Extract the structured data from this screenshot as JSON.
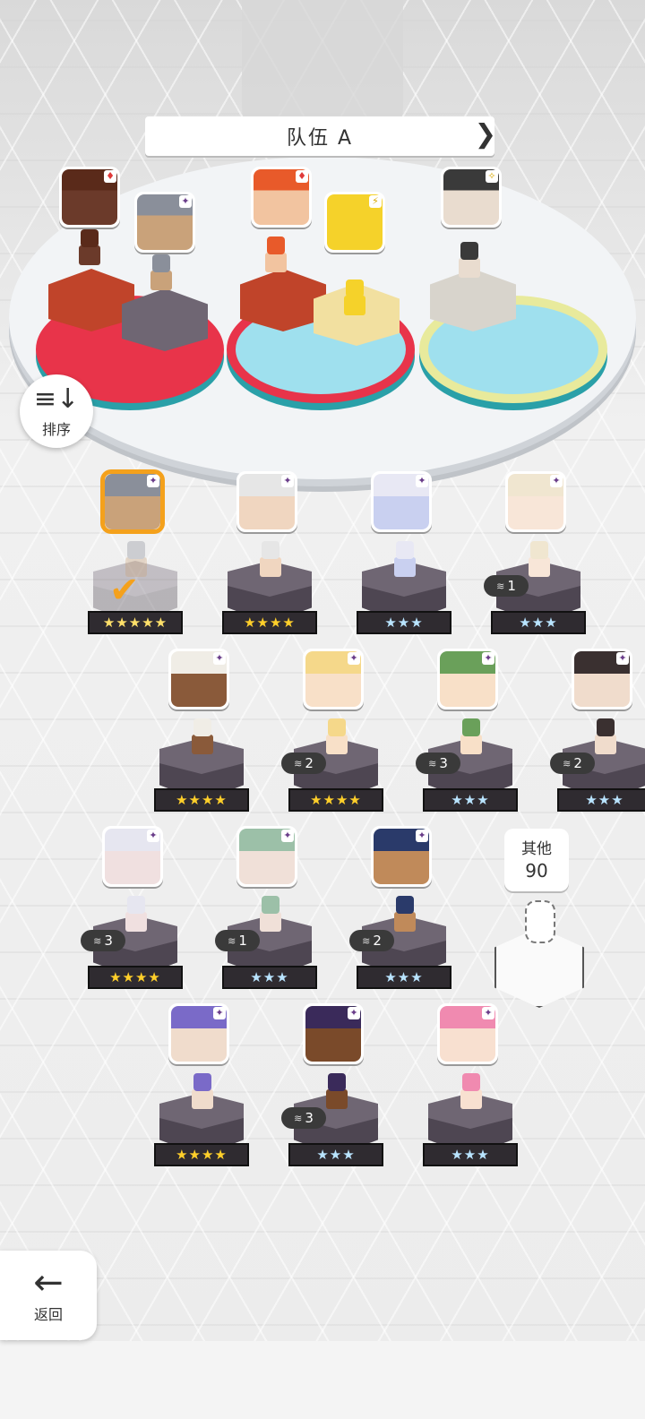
{
  "team": {
    "name": "队伍 A",
    "prev_arrow": "❮",
    "next_arrow": "❯",
    "slots": [
      {
        "ring_color": "#e8344a",
        "inner_color": "#e8344a"
      },
      {
        "ring_color": "#e8344a",
        "inner_color": "#9fe0ee"
      },
      {
        "ring_color": "#e8ea9c",
        "inner_color": "#9fe0ee"
      }
    ],
    "members": [
      {
        "name": "red-scarf-girl",
        "element": "fire",
        "element_icon": "♦",
        "skin": "#6b3a2a",
        "hair": "#5a2a1a"
      },
      {
        "name": "grey-haired-warrior",
        "element": "dark",
        "element_icon": "✦",
        "skin": "#c9a27a",
        "hair": "#8a8f9a"
      },
      {
        "name": "red-hat-witch",
        "element": "fire",
        "element_icon": "♦",
        "skin": "#f2c4a0",
        "hair": "#e85a2a"
      },
      {
        "name": "yellow-mascot",
        "element": "light",
        "element_icon": "⚡",
        "skin": "#f5d22a",
        "hair": "#f5d22a"
      },
      {
        "name": "dark-hooded-girl",
        "element": "light",
        "element_icon": "✧",
        "skin": "#e9dccf",
        "hair": "#3a3a3a"
      }
    ]
  },
  "sort": {
    "label": "排序",
    "icon": "≡↓"
  },
  "back": {
    "label": "返回",
    "icon": "←"
  },
  "others": {
    "label": "其他",
    "count": "90"
  },
  "roster": [
    {
      "id": "r1",
      "stars": "★★★★★",
      "star_style": "rainbow",
      "selected": true,
      "dupes": "",
      "hair": "#8a8f9a",
      "skin": "#c9a27a"
    },
    {
      "id": "r2",
      "stars": "★★★★",
      "star_style": "gold",
      "selected": false,
      "dupes": "",
      "hair": "#e6e6e6",
      "skin": "#f0d6c0"
    },
    {
      "id": "r3",
      "stars": "★★★",
      "star_style": "blue",
      "selected": false,
      "dupes": "",
      "hair": "#e8e8f4",
      "skin": "#c9d0f0"
    },
    {
      "id": "r4",
      "stars": "★★★",
      "star_style": "blue",
      "selected": false,
      "dupes": "1",
      "hair": "#f0e6d0",
      "skin": "#f8e6d8"
    },
    {
      "id": "r5",
      "stars": "★★★★",
      "star_style": "gold",
      "selected": false,
      "dupes": "",
      "hair": "#f0ede6",
      "skin": "#8a5a3a"
    },
    {
      "id": "r6",
      "stars": "★★★★",
      "star_style": "gold",
      "selected": false,
      "dupes": "2",
      "hair": "#f5d88a",
      "skin": "#f8e0c8"
    },
    {
      "id": "r7",
      "stars": "★★★",
      "star_style": "blue",
      "selected": false,
      "dupes": "3",
      "hair": "#6aa05a",
      "skin": "#f8e0c8"
    },
    {
      "id": "r8",
      "stars": "★★★",
      "star_style": "blue",
      "selected": false,
      "dupes": "2",
      "hair": "#3a3030",
      "skin": "#f0dccc"
    },
    {
      "id": "r9",
      "stars": "★★★★",
      "star_style": "gold",
      "selected": false,
      "dupes": "3",
      "hair": "#e6e6f0",
      "skin": "#f0e0e0"
    },
    {
      "id": "r10",
      "stars": "★★★",
      "star_style": "blue",
      "selected": false,
      "dupes": "1",
      "hair": "#9cc0a8",
      "skin": "#f0e0d8"
    },
    {
      "id": "r11",
      "stars": "★★★",
      "star_style": "blue",
      "selected": false,
      "dupes": "2",
      "hair": "#2a3a6a",
      "skin": "#c08a5a"
    },
    {
      "id": "r12",
      "stars": "★★★★",
      "star_style": "gold",
      "selected": false,
      "dupes": "",
      "hair": "#7a6ac8",
      "skin": "#f0dccc"
    },
    {
      "id": "r13",
      "stars": "★★★",
      "star_style": "blue",
      "selected": false,
      "dupes": "3",
      "hair": "#3a2a5a",
      "skin": "#7a4a2a"
    },
    {
      "id": "r14",
      "stars": "★★★",
      "star_style": "blue",
      "selected": false,
      "dupes": "",
      "hair": "#f08ab0",
      "skin": "#f8e0d0"
    }
  ]
}
